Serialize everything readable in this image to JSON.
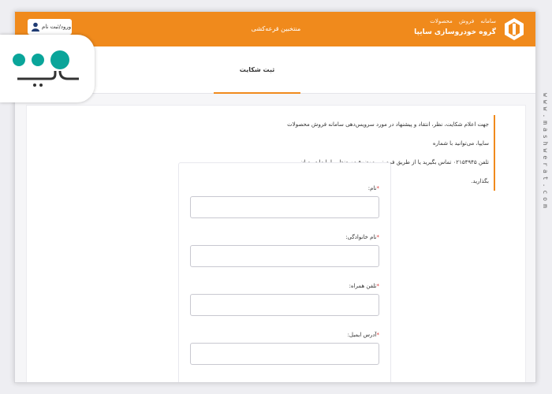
{
  "header": {
    "brand_links": [
      "سامانه",
      "فروش",
      "محصولات"
    ],
    "brand_name": "گروه خودروسازی سایپا",
    "center_title": "منتخبین قرعه‌کشی",
    "login_label": "ورود/ثبت نام",
    "accent_color": "#f08a1c"
  },
  "tabs": [
    {
      "label": "ثبت شکایت",
      "active": true
    }
  ],
  "intro": {
    "line1": "جهت اعلام شکایت، نظر، انتقاد و پیشنهاد در مورد سرویس‌دهی سامانه فروش محصولات سایپا، می‌توانید با شماره",
    "line2": "تلفن ۰۲۱۵۴۹۴۵ تماس بگیرید یا از طریق فرم زیر موضوع موردنظر را با ما در میان بگذارید."
  },
  "form": {
    "fields": [
      {
        "label": "نام:",
        "value": ""
      },
      {
        "label": "نام خانوادگی:",
        "value": ""
      },
      {
        "label": "تلفن همراه:",
        "value": ""
      },
      {
        "label": "آدرس ایمیل:",
        "value": ""
      }
    ],
    "required_mark": "*"
  },
  "watermark": "www.mashwerat.com",
  "icons": [
    "saipa-logo-icon",
    "user-icon",
    "moshaverat-logo-icon"
  ]
}
